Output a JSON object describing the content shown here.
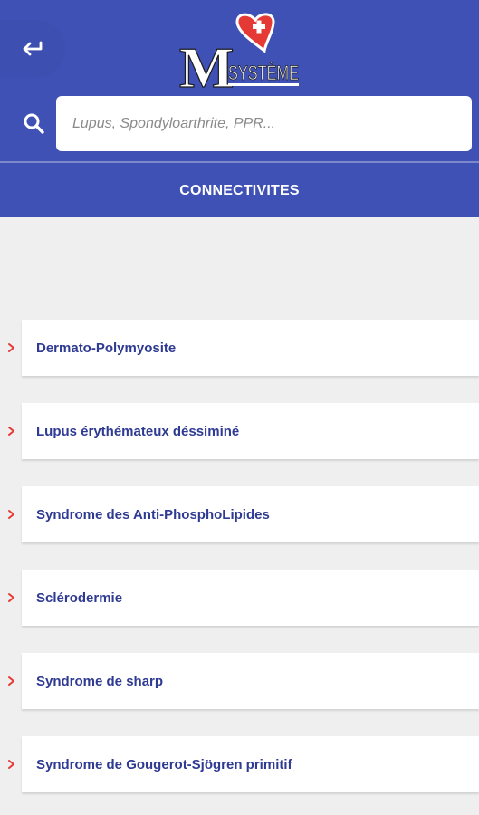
{
  "app": {
    "logo_text": "MSYSTÈME",
    "colors": {
      "primary": "#3f51b5",
      "accent_red": "#e53935",
      "text_blue": "#2f3b92"
    }
  },
  "header": {
    "back_icon": "return-arrow-icon",
    "search_icon": "search-icon",
    "search_placeholder": "Lupus, Spondyloarthrite, PPR...",
    "section_title": "CONNECTIVITES"
  },
  "items": [
    {
      "label": "Dermato-Polymyosite"
    },
    {
      "label": "Lupus érythémateux déssiminé"
    },
    {
      "label": "Syndrome des Anti-PhosphoLipides"
    },
    {
      "label": "Sclérodermie"
    },
    {
      "label": "Syndrome de sharp"
    },
    {
      "label": "Syndrome de Gougerot-Sjögren primitif"
    }
  ]
}
